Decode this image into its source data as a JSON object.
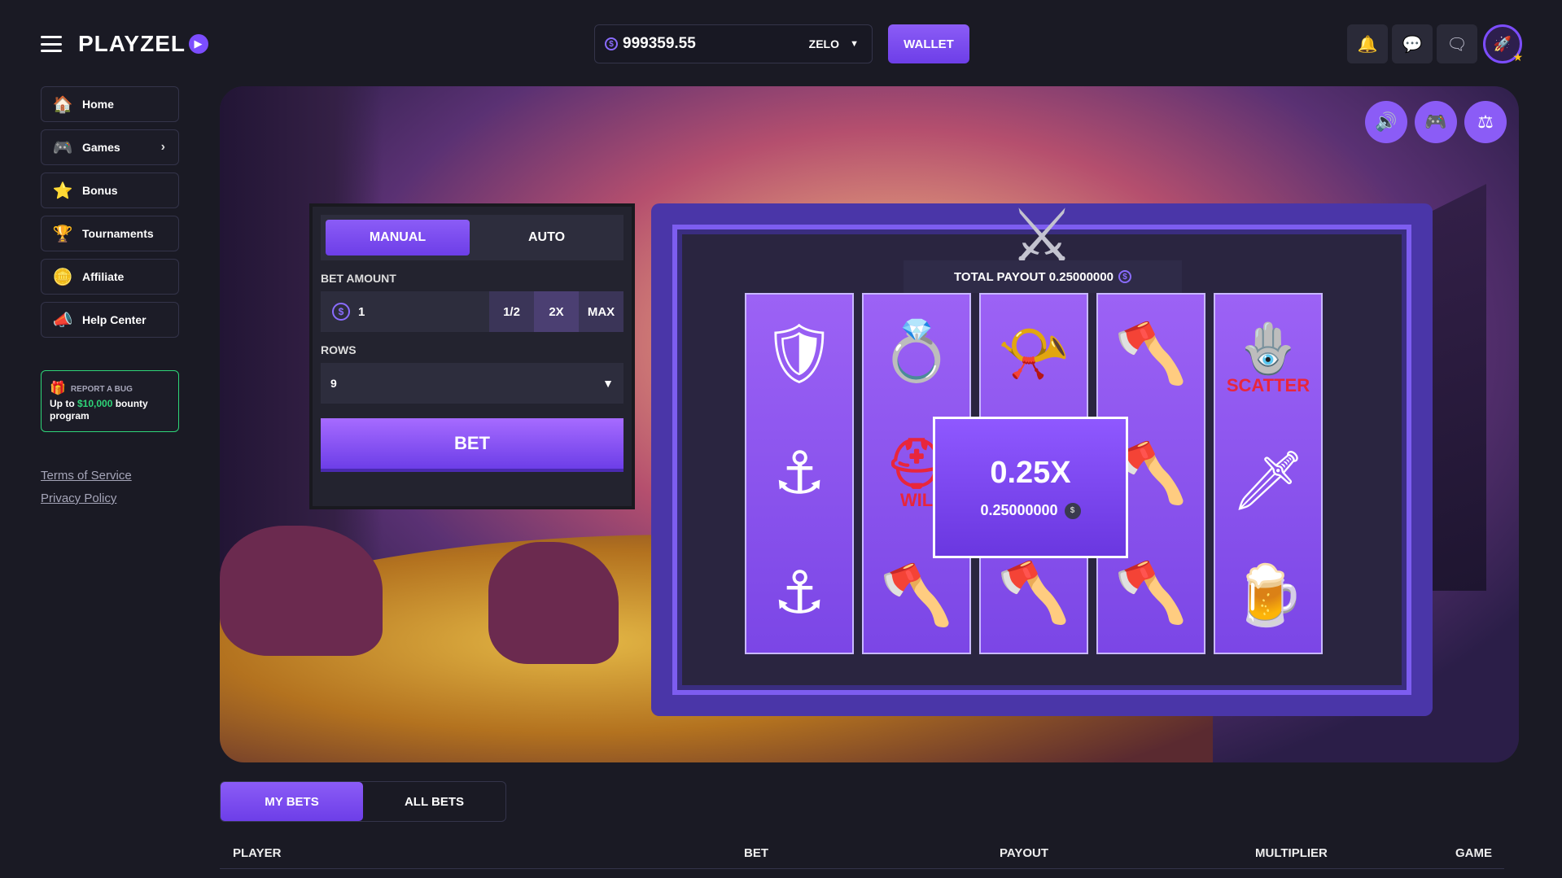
{
  "header": {
    "logo_text": "PLAYZEL",
    "balance": "999359.55",
    "currency": "ZELO",
    "wallet_label": "WALLET"
  },
  "sidebar": {
    "items": [
      {
        "label": "Home",
        "icon": "home-icon"
      },
      {
        "label": "Games",
        "icon": "gamepad-icon"
      },
      {
        "label": "Bonus",
        "icon": "star-icon"
      },
      {
        "label": "Tournaments",
        "icon": "trophy-icon"
      },
      {
        "label": "Affiliate",
        "icon": "coin-icon"
      },
      {
        "label": "Help Center",
        "icon": "megaphone-icon"
      }
    ],
    "bug_banner": {
      "title": "REPORT A BUG",
      "line_prefix": "Up to ",
      "amount": "$10,000",
      "line_suffix": " bounty program"
    },
    "links": [
      "Terms of Service",
      "Privacy Policy"
    ]
  },
  "bet_panel": {
    "tabs": [
      "MANUAL",
      "AUTO"
    ],
    "active_tab": "MANUAL",
    "bet_amount_label": "BET AMOUNT",
    "bet_amount_value": "1",
    "half_label": "1/2",
    "double_label": "2X",
    "max_label": "MAX",
    "rows_label": "ROWS",
    "rows_value": "9",
    "bet_button": "BET"
  },
  "game": {
    "total_payout_label": "TOTAL PAYOUT 0.25000000",
    "win_multiplier": "0.25X",
    "win_value": "0.25000000",
    "scatter_label": "SCATTER",
    "wild_label": "WIL"
  },
  "bets": {
    "tabs": [
      "MY BETS",
      "ALL BETS"
    ],
    "active_tab": "MY BETS",
    "columns": [
      "PLAYER",
      "BET",
      "PAYOUT",
      "MULTIPLIER",
      "GAME"
    ]
  },
  "colors": {
    "accent": "#8b5cf6",
    "background": "#1a1a24",
    "bug_border": "#2ed578"
  }
}
